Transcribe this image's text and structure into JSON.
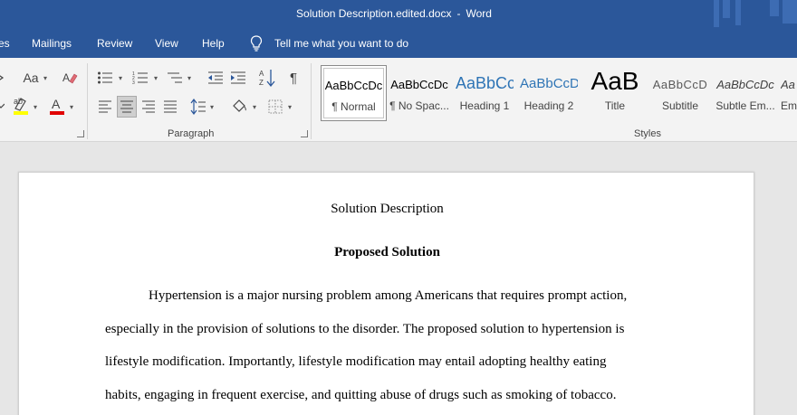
{
  "window": {
    "doc_name": "Solution Description.edited.docx",
    "separator": "-",
    "app_name": "Word"
  },
  "menu": {
    "tabs": [
      "es",
      "Mailings",
      "Review",
      "View",
      "Help"
    ],
    "tell_me": "Tell me what you want to do"
  },
  "ribbon": {
    "groups": {
      "paragraph": "Paragraph",
      "styles": "Styles"
    },
    "font_size_btn": "Aa",
    "styles": [
      {
        "preview": "AaBbCcDc",
        "name": "¶ Normal"
      },
      {
        "preview": "AaBbCcDc",
        "name": "¶ No Spac..."
      },
      {
        "preview": "AaBbCc",
        "name": "Heading 1"
      },
      {
        "preview": "AaBbCcD",
        "name": "Heading 2"
      },
      {
        "preview": "AaB",
        "name": "Title"
      },
      {
        "preview": "AaBbCcD",
        "name": "Subtitle"
      },
      {
        "preview": "AaBbCcDc",
        "name": "Subtle Em..."
      },
      {
        "preview": "Aa",
        "name": "Em"
      }
    ],
    "colors": {
      "highlight": "#ffff00",
      "font_color": "#e00000",
      "heading": "#2e74b5"
    }
  },
  "document": {
    "title": "Solution Description",
    "heading": "Proposed Solution",
    "lines": [
      "Hypertension is a major nursing problem among Americans that requires prompt action,",
      "especially in the provision of solutions to the disorder. The proposed solution to hypertension is",
      "lifestyle modification. Importantly, lifestyle modification may entail adopting healthy eating",
      "habits, engaging in frequent exercise, and quitting abuse of drugs such as smoking of tobacco."
    ]
  }
}
